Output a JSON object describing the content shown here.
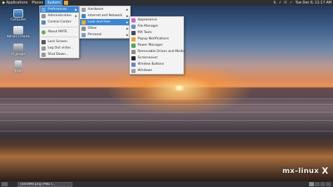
{
  "top_panel": {
    "menus": [
      "Applications",
      "Places",
      "System"
    ],
    "active_menu": "System",
    "tray": {
      "icons": [
        "network-icon",
        "volume-icon",
        "power-icon",
        "update-icon"
      ],
      "clock": "Tue Dec 6, 11:17 AM"
    }
  },
  "desktop_icons": [
    {
      "name": "computer",
      "label": "Computer"
    },
    {
      "name": "home",
      "label": "Adrian's Home"
    },
    {
      "name": "disk",
      "label": "af_plugin"
    },
    {
      "name": "trash",
      "label": "Trash"
    }
  ],
  "system_menu": {
    "items": [
      {
        "label": "Preferences",
        "submenu": true,
        "selected": true
      },
      {
        "label": "Administration",
        "submenu": true
      },
      {
        "label": "Control Center"
      },
      {
        "sep": true
      },
      {
        "label": "About MATE"
      },
      {
        "sep": true
      },
      {
        "label": "Lock Screen"
      },
      {
        "label": "Log Out victor..."
      },
      {
        "label": "Shut Down..."
      }
    ]
  },
  "preferences_menu": {
    "items": [
      {
        "label": "Hardware",
        "submenu": true
      },
      {
        "label": "Internet and Network",
        "submenu": true
      },
      {
        "label": "Look and Feel",
        "submenu": true,
        "selected": true
      },
      {
        "label": "Other",
        "submenu": true
      },
      {
        "label": "Personal",
        "submenu": true
      }
    ]
  },
  "look_and_feel_menu": {
    "items": [
      {
        "label": "Appearance",
        "color": "#c96bd3"
      },
      {
        "label": "File Manager",
        "color": "#6e8fb8"
      },
      {
        "label": "MX Tools",
        "color": "#4a4a4a"
      },
      {
        "label": "Popup Notifications",
        "color": "#e0a640"
      },
      {
        "label": "Power Manager",
        "color": "#5aa34a"
      },
      {
        "label": "Removable Drives and Media",
        "color": "#8c8c8c"
      },
      {
        "label": "Screensaver",
        "color": "#2a2a2a"
      },
      {
        "label": "Window Buttons",
        "color": "#6a84c2"
      },
      {
        "label": "Windows",
        "color": "#9aa3ad"
      }
    ]
  },
  "bottom_panel": {
    "task": "[sdndMX.png (PNG I...",
    "workspaces": 4,
    "active_workspace": 1
  },
  "branding": {
    "logo": "mx-linux",
    "mark": "X"
  }
}
